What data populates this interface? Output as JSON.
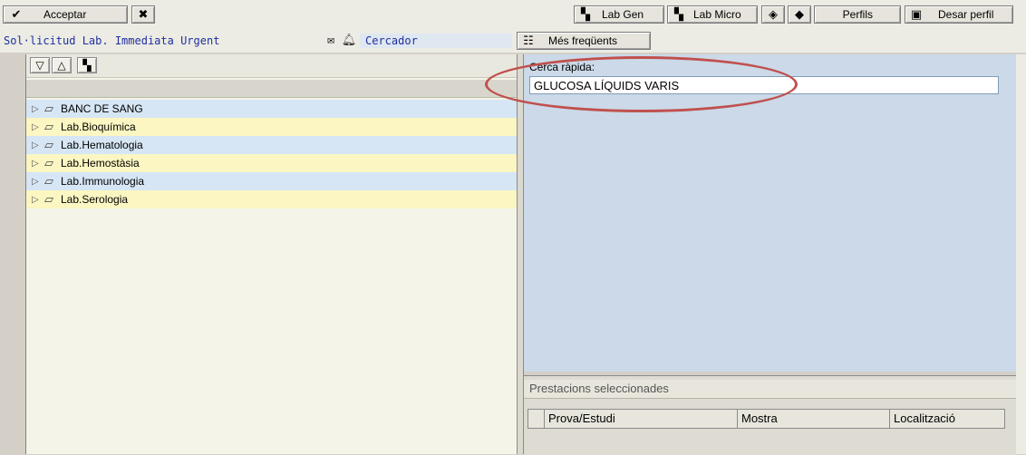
{
  "toolbar": {
    "accept_label": "Acceptar",
    "lab_gen_label": "Lab Gen",
    "lab_micro_label": "Lab Micro",
    "perfils_label": "Perfils",
    "save_profile_label": "Desar perfil"
  },
  "context": {
    "request_type": "Sol·licitud Lab. Immediata Urgent",
    "cercador_value": "Cercador",
    "frequent_label": "Més freqüents"
  },
  "tree": {
    "items": [
      {
        "label": "BANC DE SANG"
      },
      {
        "label": "Lab.Bioquímica"
      },
      {
        "label": "Lab.Hematologia"
      },
      {
        "label": "Lab.Hemostàsia"
      },
      {
        "label": "Lab.Immunologia"
      },
      {
        "label": "Lab.Serologia"
      }
    ]
  },
  "search": {
    "label": "Cerca ràpida:",
    "value": "GLUCOSA LÍQUIDS VARIS"
  },
  "selection": {
    "title": "Prestacions seleccionades",
    "columns": [
      "Prova/Estudi",
      "Mostra",
      "Localització"
    ]
  },
  "icons": {
    "check": "check-icon",
    "cancel": "cancel-icon",
    "binoculars": "binoculars-icon",
    "envelope": "envelope-icon",
    "bell": "bell-icon",
    "tree_node": "folder-node-icon",
    "expand_triangle": "expand-triangle-icon"
  },
  "colors": {
    "highlight": "#c0504d",
    "tree_row_blue": "#d6e6f5",
    "tree_row_yellow": "#fbf6c2",
    "right_panel": "#cbd9e8",
    "context_text": "#1f2fa0"
  }
}
